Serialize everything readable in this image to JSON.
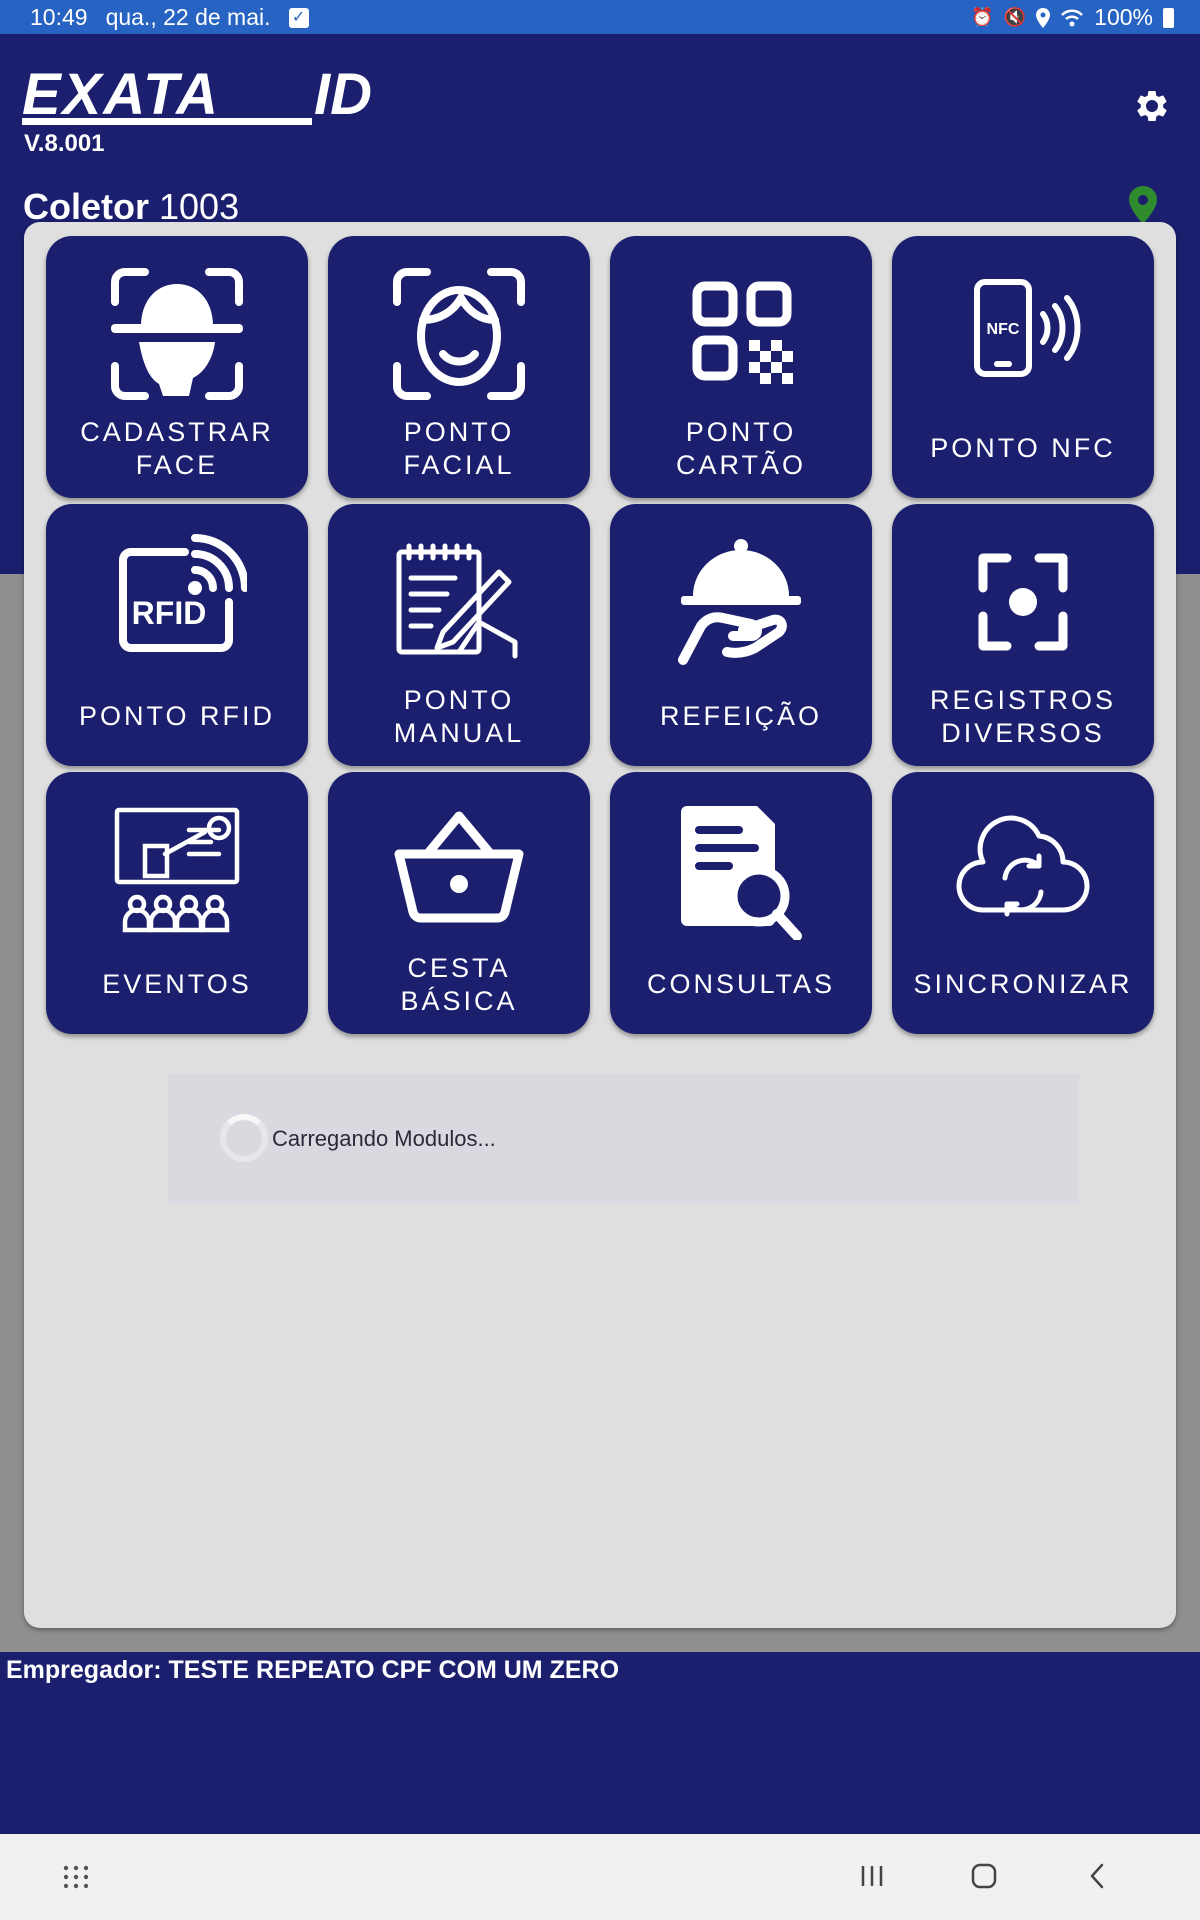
{
  "status_bar": {
    "time": "10:49",
    "date": "qua., 22 de mai.",
    "battery": "100%",
    "icons": [
      "checkbox-notification-icon",
      "alarm-icon",
      "mute-icon",
      "location-icon",
      "wifi-icon",
      "battery-icon"
    ]
  },
  "header": {
    "logo_text": "EXATA ID",
    "version": "V.8.001",
    "collector_label": "Coletor",
    "collector_id": "1003",
    "settings_icon": "gear-icon",
    "location_icon": "map-pin-icon"
  },
  "tiles": [
    {
      "label": "CADASTRAR\nFACE",
      "icon": "face-scan-icon"
    },
    {
      "label": "PONTO\nFACIAL",
      "icon": "facial-recognition-icon"
    },
    {
      "label": "PONTO\nCARTÃO",
      "icon": "qr-code-icon"
    },
    {
      "label": "PONTO NFC",
      "icon": "nfc-phone-icon"
    },
    {
      "label": "PONTO RFID",
      "icon": "rfid-icon"
    },
    {
      "label": "PONTO\nMANUAL",
      "icon": "manual-notepad-icon"
    },
    {
      "label": "REFEIÇÃO",
      "icon": "meal-cloche-icon"
    },
    {
      "label": "REGISTROS\nDIVERSOS",
      "icon": "focus-target-icon"
    },
    {
      "label": "EVENTOS",
      "icon": "presentation-event-icon"
    },
    {
      "label": "CESTA\nBÁSICA",
      "icon": "basket-icon"
    },
    {
      "label": "CONSULTAS",
      "icon": "document-search-icon"
    },
    {
      "label": "SINCRONIZAR",
      "icon": "cloud-sync-icon"
    }
  ],
  "loading": {
    "text": "Carregando Modulos..."
  },
  "footer": {
    "employer_text": "Empregador: TESTE REPEATO CPF COM UM ZERO"
  },
  "navbar": {
    "icons": [
      "apps-grid-icon",
      "recent-apps-icon",
      "home-icon",
      "back-icon"
    ]
  },
  "colors": {
    "primary": "#1b1f6e",
    "status_bar": "#2663c2",
    "panel": "#dfdfdf",
    "pin": "#2e8b2e"
  }
}
